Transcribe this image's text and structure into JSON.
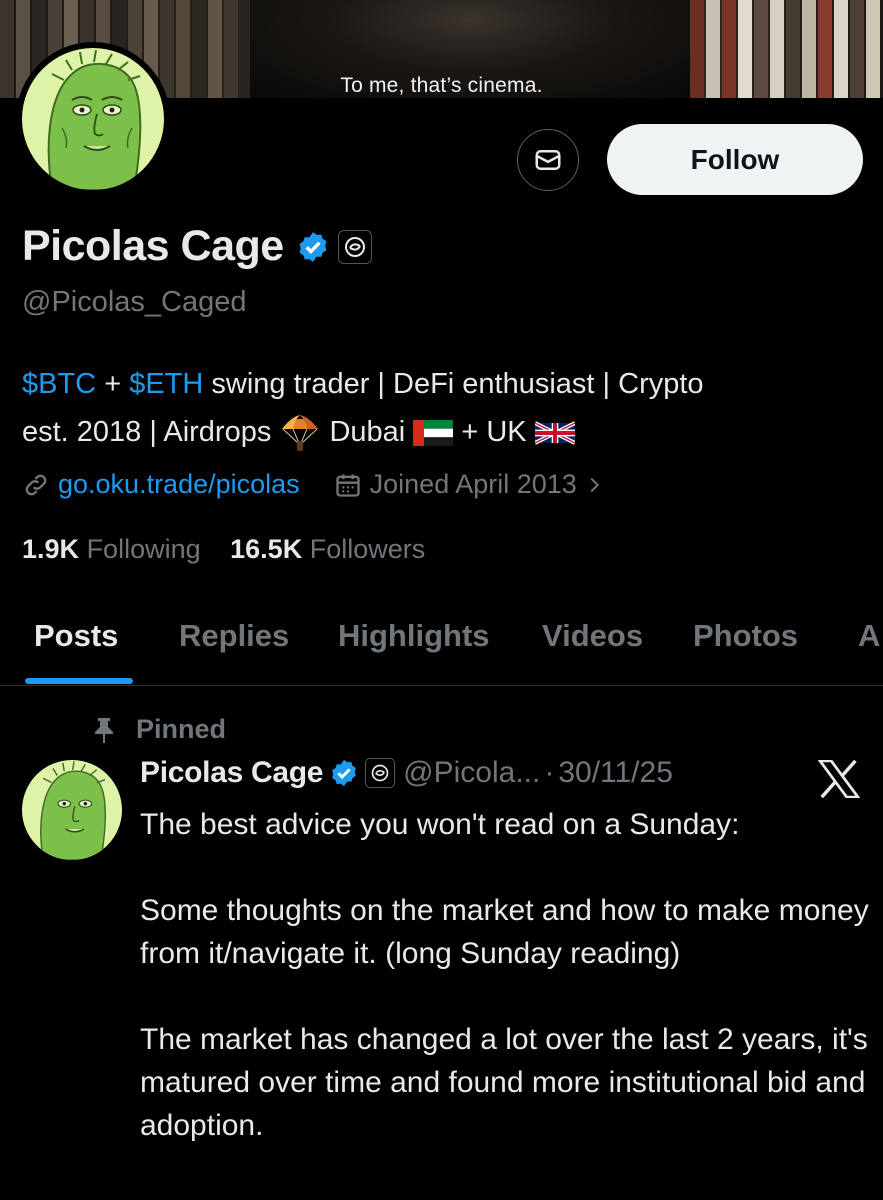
{
  "banner": {
    "caption": "To me, that’s cinema."
  },
  "actions": {
    "follow_label": "Follow"
  },
  "profile": {
    "display_name": "Picolas Cage",
    "handle": "@Picolas_Caged",
    "bio_line1": {
      "tag1": "$BTC",
      "plus": " + ",
      "tag2": "$ETH",
      "rest": " swing trader | DeFi enthusiast | Crypto"
    },
    "bio_line2": {
      "start": "est. 2018 | Airdrops ",
      "dubai": " Dubai ",
      "uk": " + UK "
    },
    "website": "go.oku.trade/picolas",
    "joined": "Joined April 2013",
    "following_count": "1.9K",
    "following_label": "Following",
    "followers_count": "16.5K",
    "followers_label": "Followers"
  },
  "tabs": [
    {
      "label": "Posts",
      "active": true
    },
    {
      "label": "Replies"
    },
    {
      "label": "Highlights"
    },
    {
      "label": "Videos"
    },
    {
      "label": "Photos"
    },
    {
      "label": "A"
    }
  ],
  "tweet": {
    "pinned_label": "Pinned",
    "author_name": "Picolas Cage",
    "author_handle": "@Picola...",
    "separator": "·",
    "date": "30/11/25",
    "paragraphs": [
      "The best advice you won't read on a Sunday:",
      "Some thoughts on the market and how to make money from it/navigate it. (long Sunday reading)",
      "The market has changed a lot over the last 2 years, it's  matured over time and found more institutional bid and adoption."
    ]
  },
  "colors": {
    "accent": "#1d9bf0",
    "muted": "#71767b",
    "text": "#e7e9ea",
    "background": "#000000"
  },
  "icons": [
    "mail-icon",
    "verified-badge-icon",
    "affiliate-badge-icon",
    "link-icon",
    "calendar-icon",
    "chevron-right-icon",
    "pin-icon",
    "x-logo-icon",
    "parachute-emoji",
    "uae-flag",
    "uk-flag"
  ]
}
